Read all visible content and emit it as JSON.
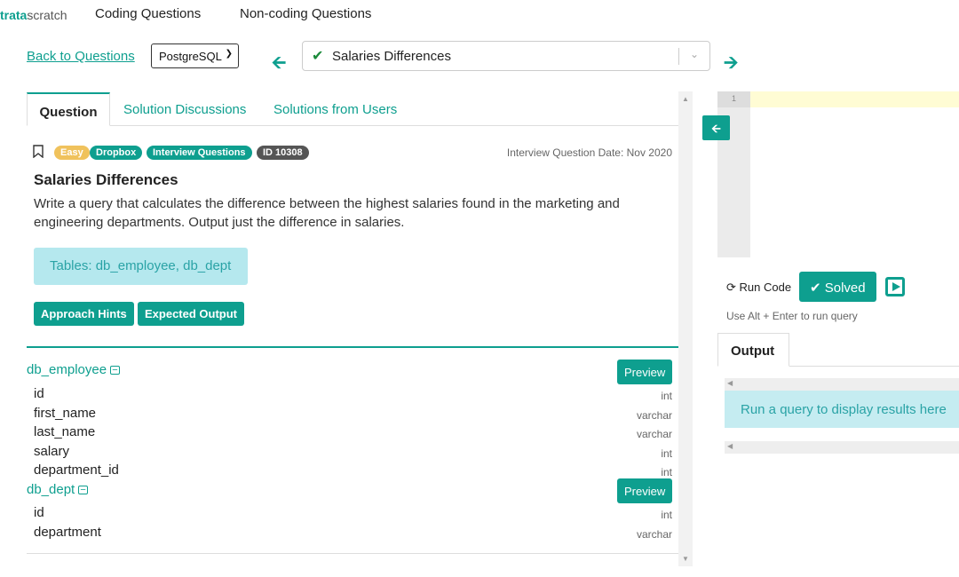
{
  "nav": {
    "logo_bold": "trata",
    "logo_rest": "scratch",
    "links": [
      "Coding Questions",
      "Non-coding Questions"
    ]
  },
  "toolbar": {
    "back_label": "Back to Questions",
    "language": "PostgreSQL",
    "question_select": "Salaries Differences"
  },
  "tabs": [
    "Question",
    "Solution Discussions",
    "Solutions from Users"
  ],
  "question": {
    "badges": [
      {
        "label": "Easy",
        "color": "#f0c25c"
      },
      {
        "label": "Dropbox",
        "color": "#0e9f8f"
      },
      {
        "label": "Interview Questions",
        "color": "#0e9f8f"
      },
      {
        "label": "ID 10308",
        "color": "#555555"
      }
    ],
    "date": "Interview Question Date: Nov 2020",
    "title": "Salaries Differences",
    "description": "Write a query that calculates the difference between the highest salaries found in the marketing and engineering departments. Output just the difference in salaries.",
    "tables_label": "Tables: db_employee, db_dept",
    "approach_hints": "Approach Hints",
    "expected_output": "Expected Output"
  },
  "schema": [
    {
      "name": "db_employee",
      "preview": "Preview",
      "columns": [
        {
          "name": "id",
          "type": "int"
        },
        {
          "name": "first_name",
          "type": "varchar"
        },
        {
          "name": "last_name",
          "type": "varchar"
        },
        {
          "name": "salary",
          "type": "int"
        },
        {
          "name": "department_id",
          "type": "int"
        }
      ]
    },
    {
      "name": "db_dept",
      "preview": "Preview",
      "columns": [
        {
          "name": "id",
          "type": "int"
        },
        {
          "name": "department",
          "type": "varchar"
        }
      ]
    }
  ],
  "editor": {
    "line_number": "1",
    "run_code": "Run Code",
    "solved": "Solved",
    "shortcut_hint": "Use Alt + Enter to run query"
  },
  "output": {
    "tab": "Output",
    "message": "Run a query to display results here"
  }
}
